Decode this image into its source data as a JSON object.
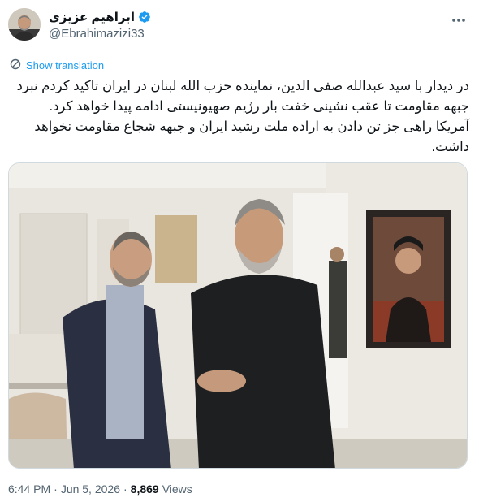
{
  "author": {
    "display_name": "ابراهیم عزیزی",
    "handle": "@Ebrahimazizi33",
    "verified_color": "#1d9bf0"
  },
  "icons": {
    "more": "more-options-icon",
    "verified": "verified-badge-icon",
    "translate": "translate-icon"
  },
  "tweet": {
    "show_translation": "Show translation",
    "lines": [
      "در دیدار با سید عبدالله صفی الدین، نماینده حزب الله لبنان در ایران تاکید کردم نبرد",
      "جبهه مقاومت تا عقب نشینی خفت بار رژیم صهیونیستی ادامه پیدا خواهد کرد.",
      "آمریکا راهی جز تن دادن به اراده ملت رشید ایران و جبهه شجاع مقاومت نخواهد",
      "داشت."
    ]
  },
  "meta": {
    "time": "6:44 PM",
    "sep": "·",
    "date": "Jun 5, 2026",
    "sep2": "·",
    "views_count": "8,869",
    "views_label": "Views"
  }
}
